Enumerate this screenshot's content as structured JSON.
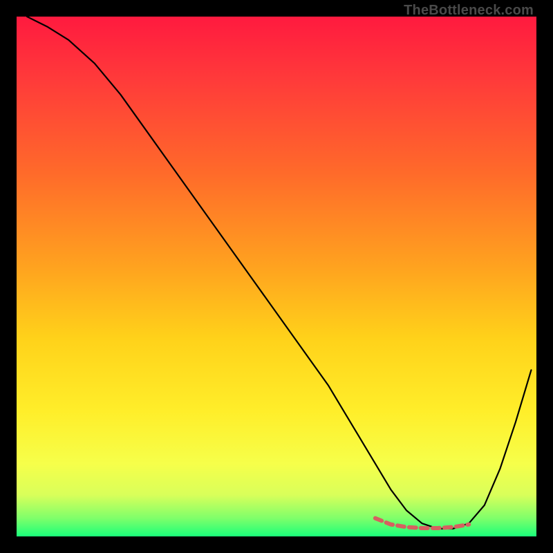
{
  "watermark": "TheBottleneck.com",
  "chart_data": {
    "type": "line",
    "title": "",
    "xlabel": "",
    "ylabel": "",
    "xlim": [
      0,
      100
    ],
    "ylim": [
      0,
      100
    ],
    "grid": false,
    "legend": false,
    "annotations": [],
    "series": [
      {
        "name": "bottleneck-curve",
        "color": "#000000",
        "x": [
          2,
          6,
          10,
          15,
          20,
          25,
          30,
          35,
          40,
          45,
          50,
          55,
          60,
          63,
          66,
          69,
          72,
          75,
          78,
          81,
          84,
          87,
          90,
          93,
          96,
          99
        ],
        "y": [
          100,
          98,
          95.5,
          91,
          85,
          78,
          71,
          64,
          57,
          50,
          43,
          36,
          29,
          24,
          19,
          14,
          9,
          5,
          2.5,
          1.5,
          1.5,
          2.5,
          6,
          13,
          22,
          32
        ]
      },
      {
        "name": "optimal-zone-highlight",
        "color": "#d66060",
        "x": [
          69,
          72,
          75,
          78,
          81,
          84,
          87
        ],
        "y": [
          3.5,
          2.3,
          1.8,
          1.6,
          1.6,
          1.8,
          2.3
        ]
      }
    ],
    "gradient_stops": [
      {
        "offset": 0.0,
        "color": "#ff1a3f"
      },
      {
        "offset": 0.12,
        "color": "#ff3a3a"
      },
      {
        "offset": 0.3,
        "color": "#ff6a2a"
      },
      {
        "offset": 0.48,
        "color": "#ffa21f"
      },
      {
        "offset": 0.62,
        "color": "#ffd21a"
      },
      {
        "offset": 0.76,
        "color": "#ffee2a"
      },
      {
        "offset": 0.86,
        "color": "#f6ff4a"
      },
      {
        "offset": 0.92,
        "color": "#d9ff5a"
      },
      {
        "offset": 0.965,
        "color": "#7fff6a"
      },
      {
        "offset": 1.0,
        "color": "#1aff7a"
      }
    ]
  }
}
